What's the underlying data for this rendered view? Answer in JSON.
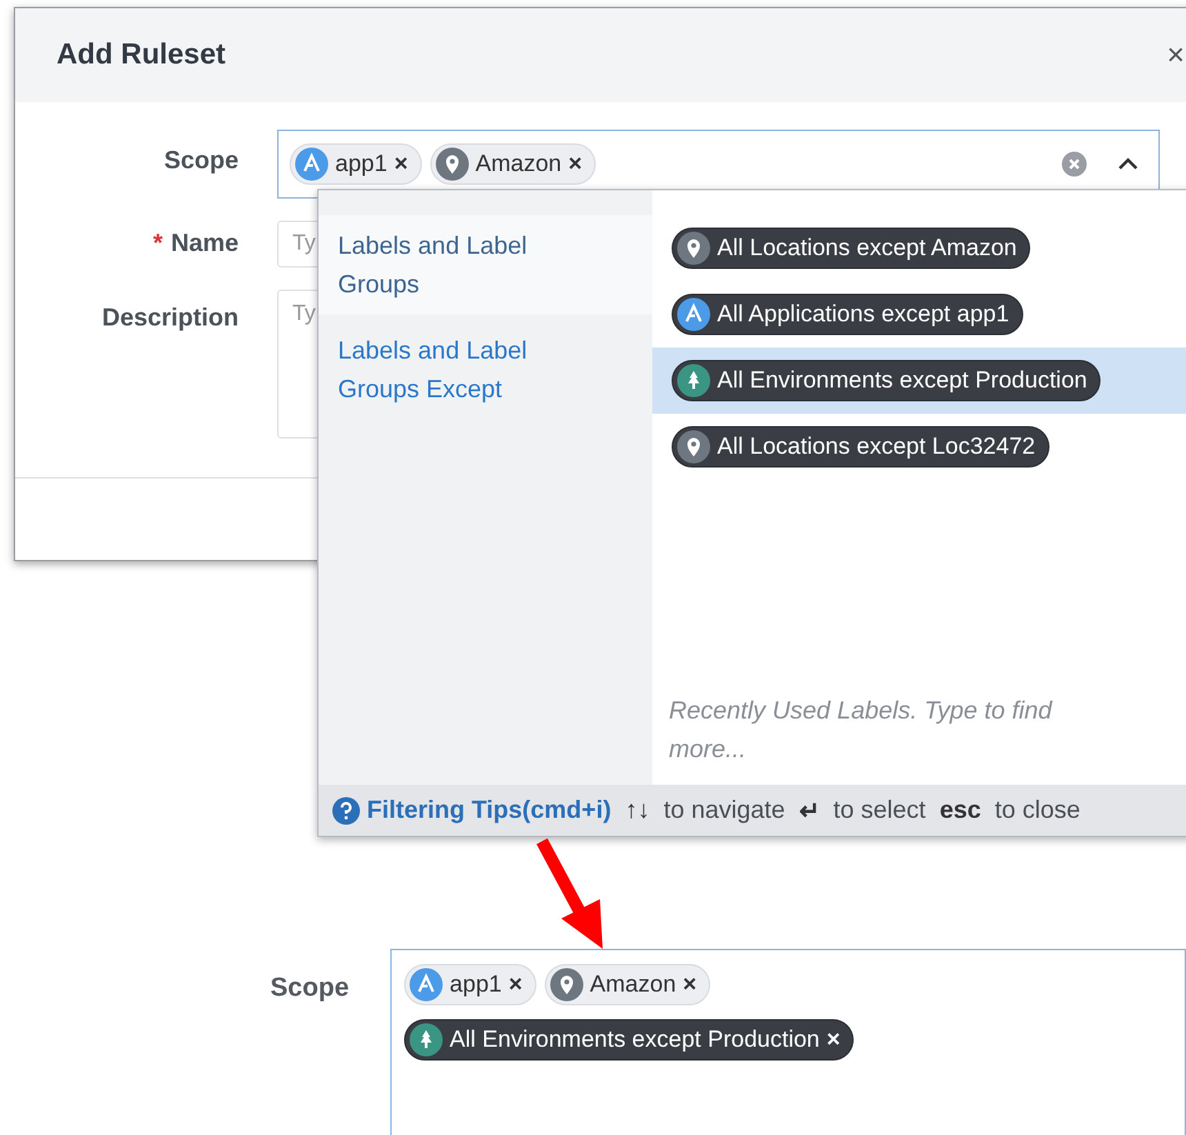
{
  "dialog": {
    "title": "Add Ruleset",
    "close": "×",
    "fields": [
      {
        "kind": "scope",
        "label": "Scope",
        "expanded": true,
        "chips": [
          {
            "kind": "application",
            "label": "app1",
            "remove": "×"
          },
          {
            "kind": "location",
            "label": "Amazon",
            "remove": "×"
          }
        ]
      },
      {
        "kind": "text",
        "label": "Name",
        "required": true,
        "required_mark": "*",
        "placeholder": "Ty"
      },
      {
        "kind": "textarea",
        "label": "Description",
        "placeholder": "Ty"
      }
    ]
  },
  "dropdown": {
    "categories": [
      {
        "label": "Labels and Label Groups",
        "selected": false
      },
      {
        "label": "Labels and Label Groups Except",
        "selected": true
      }
    ],
    "options": [
      {
        "kind": "location",
        "label": "All Locations except Amazon",
        "selected": false
      },
      {
        "kind": "application",
        "label": "All Applications except app1",
        "selected": false
      },
      {
        "kind": "environment",
        "label": "All Environments except Production",
        "selected": true
      },
      {
        "kind": "location",
        "label": "All Locations except Loc32472",
        "selected": false
      }
    ],
    "hint": "Recently Used Labels. Type to find more...",
    "footer": {
      "tips": "Filtering Tips(cmd+i)",
      "navigate_keys": "↑↓",
      "navigate": "to navigate",
      "select_key": "↵",
      "select": "to select",
      "esc_key": "esc",
      "close": "to close"
    }
  },
  "result": {
    "label": "Scope",
    "chips": [
      {
        "kind": "application",
        "label": "app1",
        "remove": "×",
        "dark": false
      },
      {
        "kind": "location",
        "label": "Amazon",
        "remove": "×",
        "dark": false
      },
      {
        "kind": "environment",
        "label": "All Environments except Production",
        "remove": "×",
        "dark": true
      }
    ]
  }
}
